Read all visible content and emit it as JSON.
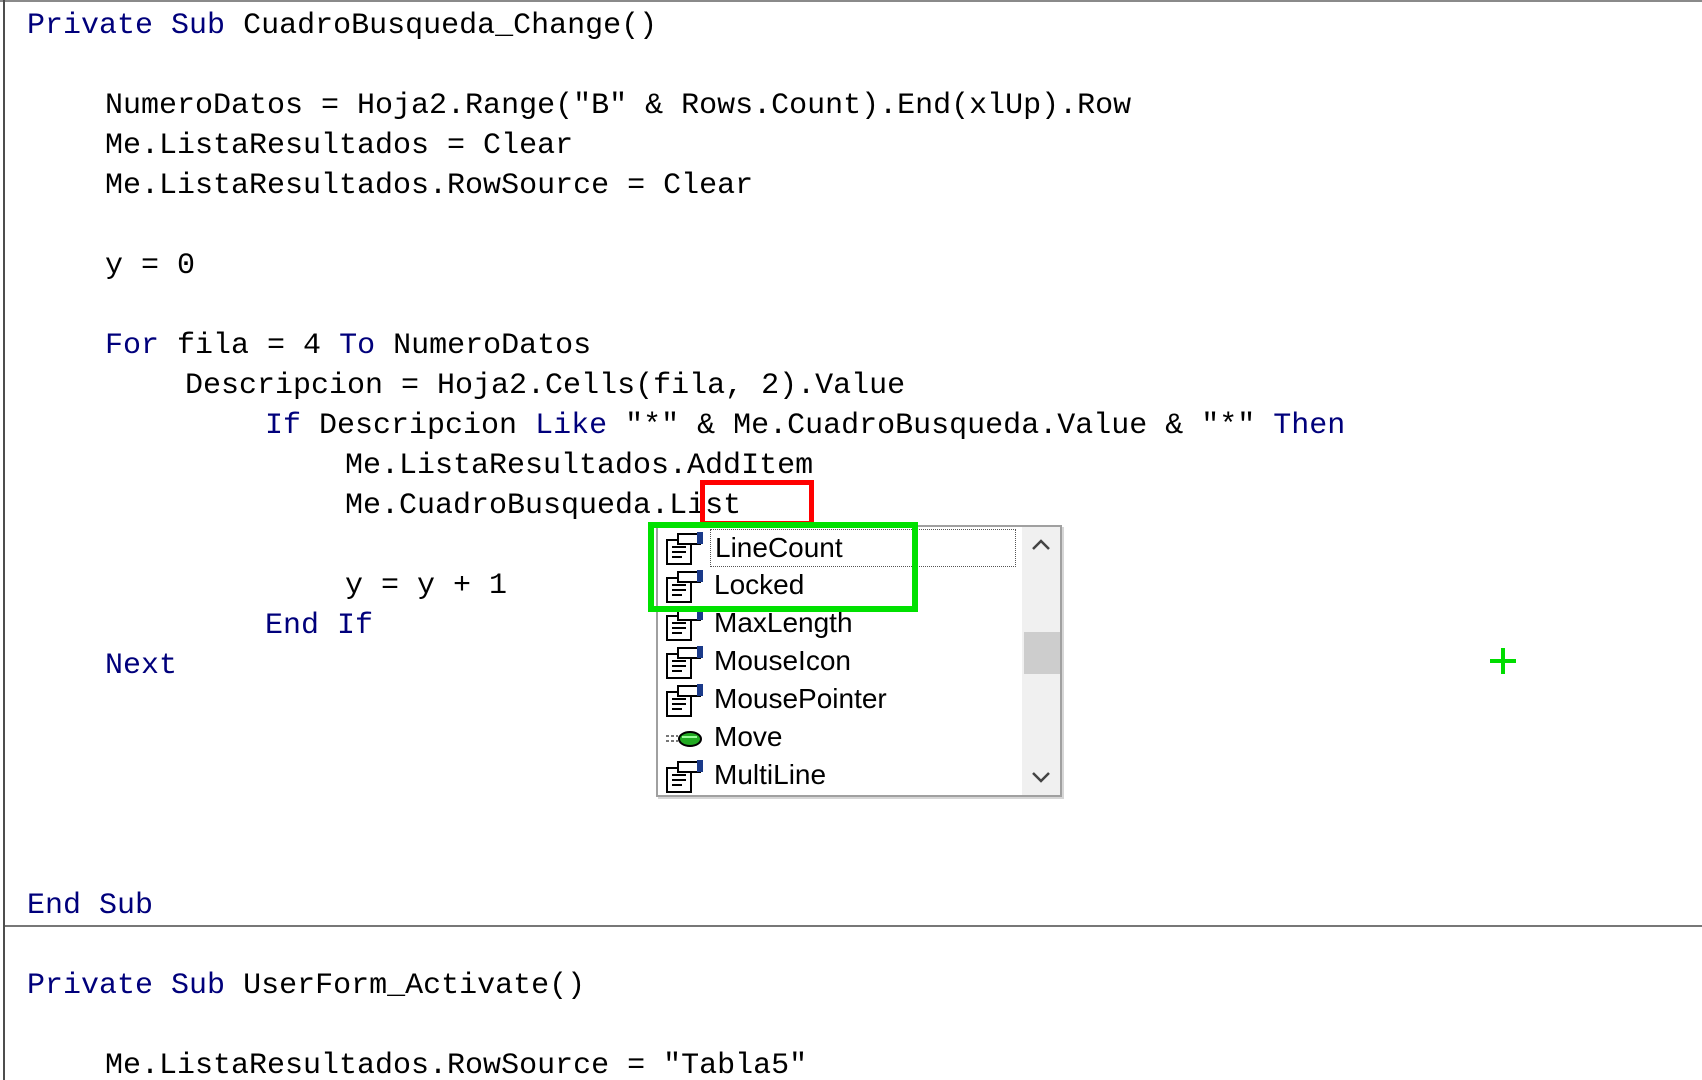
{
  "code": {
    "l1": {
      "private": "Private",
      "sub": "Sub",
      "name": "CuadroBusqueda_Change()"
    },
    "l2": {
      "text": "NumeroDatos = Hoja2.Range(\"B\" & Rows.Count).End(xlUp).Row"
    },
    "l3": {
      "text": "Me.ListaResultados = Clear"
    },
    "l4": {
      "text": "Me.ListaResultados.RowSource = Clear"
    },
    "l5": {
      "text": "y = 0"
    },
    "l6": {
      "for": "For",
      "mid": "fila = 4",
      "to": "To",
      "end": "NumeroDatos"
    },
    "l7": {
      "text": "Descripcion = Hoja2.Cells(fila, 2).Value"
    },
    "l8": {
      "if": "If",
      "a": "Descripcion",
      "like": "Like",
      "b": "\"*\" & Me.CuadroBusqueda.Value & \"*\"",
      "then": "Then"
    },
    "l9": {
      "text": "Me.ListaResultados.AddItem"
    },
    "l10": {
      "obj": "Me.CuadroBusqueda.",
      "typed": "List"
    },
    "l11": {
      "text": "y = y + 1"
    },
    "l12": {
      "text": "End If"
    },
    "l13": {
      "text": "Next"
    },
    "l14": {
      "text": "End Sub"
    },
    "l15": {
      "private": "Private",
      "sub": "Sub",
      "name": "UserForm_Activate()"
    },
    "l16": {
      "text": "Me.ListaResultados.RowSource = \"Tabla5\""
    }
  },
  "autocomplete": {
    "items": [
      {
        "label": "LineCount",
        "icon": "property-icon",
        "selected": true
      },
      {
        "label": "Locked",
        "icon": "property-icon"
      },
      {
        "label": "MaxLength",
        "icon": "property-icon"
      },
      {
        "label": "MouseIcon",
        "icon": "property-icon"
      },
      {
        "label": "MousePointer",
        "icon": "property-icon"
      },
      {
        "label": "Move",
        "icon": "method-icon"
      },
      {
        "label": "MultiLine",
        "icon": "property-icon"
      }
    ],
    "scroll_position": 0.45
  },
  "colors": {
    "keyword": "#00007b",
    "highlight_red": "#ff0000",
    "highlight_green": "#00e100"
  }
}
